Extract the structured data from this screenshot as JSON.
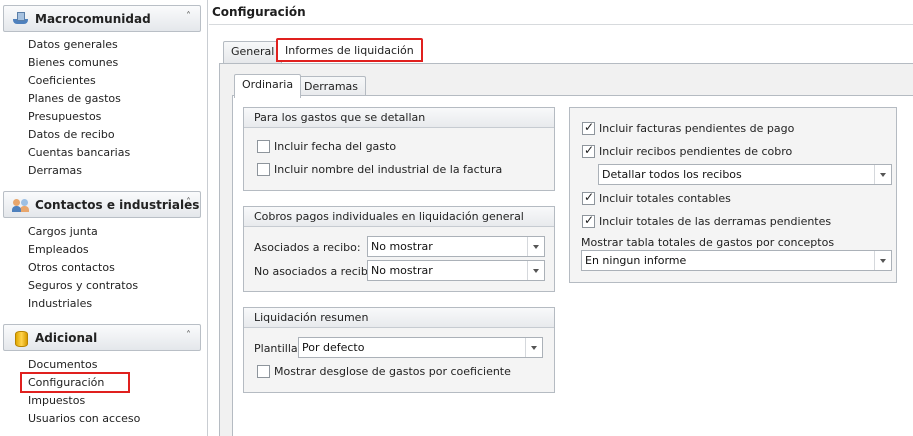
{
  "sidebar": {
    "groups": [
      {
        "title": "Macrocomunidad",
        "icon": "ship-icon",
        "items": [
          "Datos generales",
          "Bienes comunes",
          "Coeficientes",
          "Planes de gastos",
          "Presupuestos",
          "Datos de recibo",
          "Cuentas bancarias",
          "Derramas"
        ]
      },
      {
        "title": "Contactos e industriales",
        "icon": "people-icon",
        "items": [
          "Cargos junta",
          "Empleados",
          "Otros contactos",
          "Seguros y contratos",
          "Industriales"
        ]
      },
      {
        "title": "Adicional",
        "icon": "database-icon",
        "items": [
          "Documentos",
          "Configuración",
          "Impuestos",
          "Usuarios con acceso"
        ]
      }
    ],
    "selected_item": "Configuración",
    "highlight_color": "#e0201e"
  },
  "main": {
    "title": "Configuración",
    "tabs": [
      {
        "label": "General"
      },
      {
        "label": "Informes de liquidación"
      }
    ],
    "active_tab": "Informes de liquidación",
    "subtabs": [
      {
        "label": "Ordinaria"
      },
      {
        "label": "Derramas"
      }
    ],
    "active_subtab": "Ordinaria",
    "gastos_group": {
      "title": "Para los gastos que se detallan",
      "options": [
        {
          "label": "Incluir fecha del gasto",
          "checked": false
        },
        {
          "label": "Incluir nombre del industrial de la factura",
          "checked": false
        }
      ]
    },
    "cobros_group": {
      "title": "Cobros pagos individuales en liquidación general",
      "fields": [
        {
          "label": "Asociados a recibo:",
          "value": "No mostrar"
        },
        {
          "label": "No asociados a recibo:",
          "value": "No mostrar"
        }
      ]
    },
    "resumen_group": {
      "title": "Liquidación resumen",
      "plantilla_label": "Plantilla:",
      "plantilla_value": "Por defecto",
      "desglose": {
        "label": "Mostrar desglose de gastos por coeficiente",
        "checked": false
      }
    },
    "right_group": {
      "facturas": {
        "label": "Incluir facturas pendientes de pago",
        "checked": true
      },
      "recibos": {
        "label": "Incluir recibos pendientes de cobro",
        "checked": true
      },
      "recibos_combo": "Detallar todos los recibos",
      "totales": {
        "label": "Incluir totales contables",
        "checked": true
      },
      "derramas": {
        "label": "Incluir totales de las derramas pendientes",
        "checked": true
      },
      "tabla_label": "Mostrar tabla totales de gastos por conceptos",
      "tabla_combo": "En ningun informe"
    }
  }
}
